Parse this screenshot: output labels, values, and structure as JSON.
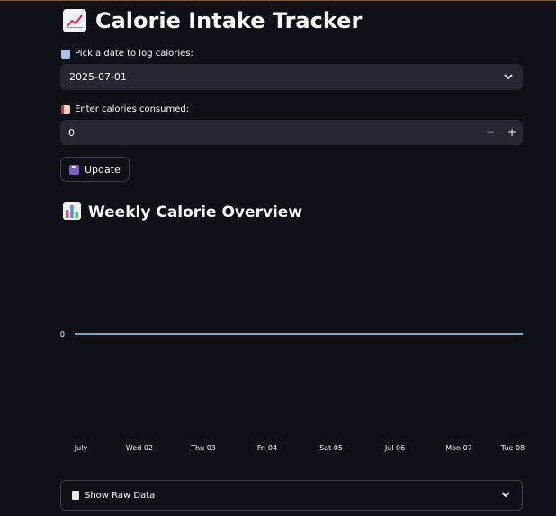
{
  "app": {
    "title": "Calorie Intake Tracker"
  },
  "date_picker": {
    "label": "Pick a date to log calories:",
    "value": "2025-07-01"
  },
  "calories_input": {
    "label": "Enter calories consumed:",
    "value": "0",
    "decrement": "−",
    "increment": "+"
  },
  "update_button": {
    "label": "Update"
  },
  "overview": {
    "title": "Weekly Calorie Overview"
  },
  "raw_data_expander": {
    "label": "Show Raw Data"
  },
  "colors": {
    "background": "#0e1117",
    "input": "#262730",
    "line": "#7fa6c9"
  },
  "chart_data": {
    "type": "line",
    "x": [
      "July",
      "Wed 02",
      "Thu 03",
      "Fri 04",
      "Sat 05",
      "Jul 06",
      "Mon 07",
      "Tue 08"
    ],
    "categories": [
      "July",
      "Wed 02",
      "Thu 03",
      "Fri 04",
      "Sat 05",
      "Jul 06",
      "Mon 07",
      "Tue 08"
    ],
    "series": [
      {
        "values": [
          0,
          0,
          0,
          0,
          0,
          0,
          0,
          0
        ]
      }
    ],
    "y_ticks": [
      "0"
    ],
    "title": "",
    "xlabel": "",
    "ylabel": "",
    "grid": false
  }
}
